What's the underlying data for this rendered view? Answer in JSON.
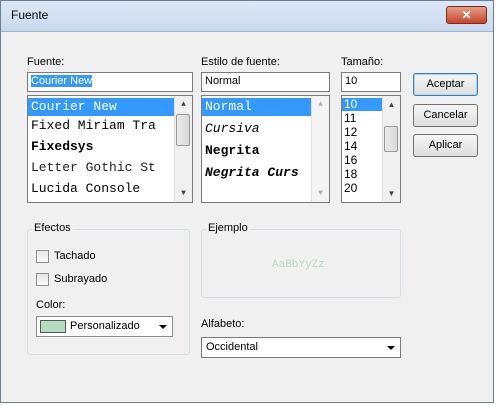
{
  "window": {
    "title": "Fuente",
    "close_glyph": "✕"
  },
  "font": {
    "label": "Fuente:",
    "value": "Courier New",
    "items": [
      "Courier New",
      "Fixed Miriam Tra",
      "Fixedsys",
      "Letter Gothic St",
      "Lucida Console"
    ]
  },
  "style": {
    "label": "Estilo de fuente:",
    "value": "Normal",
    "items": [
      "Normal",
      "Cursiva",
      "Negrita",
      "Negrita Curs"
    ]
  },
  "size": {
    "label": "Tamaño:",
    "value": "10",
    "items": [
      "10",
      "11",
      "12",
      "14",
      "16",
      "18",
      "20"
    ]
  },
  "buttons": {
    "ok": "Aceptar",
    "cancel": "Cancelar",
    "apply": "Aplicar"
  },
  "effects": {
    "title": "Efectos",
    "strikeout": "Tachado",
    "underline": "Subrayado",
    "color_label": "Color:",
    "color_value": "Personalizado",
    "color_swatch": "#b5dcc0"
  },
  "sample": {
    "title": "Ejemplo",
    "text": "AaBbYyZz"
  },
  "script": {
    "label": "Alfabeto:",
    "value": "Occidental"
  },
  "colors": {
    "selection": "#3399ff",
    "close_button": "#c8452c"
  },
  "icons": {
    "close": "close-icon",
    "scroll_up": "scroll-up-icon",
    "scroll_down": "scroll-down-icon",
    "dropdown": "chevron-down-icon"
  }
}
